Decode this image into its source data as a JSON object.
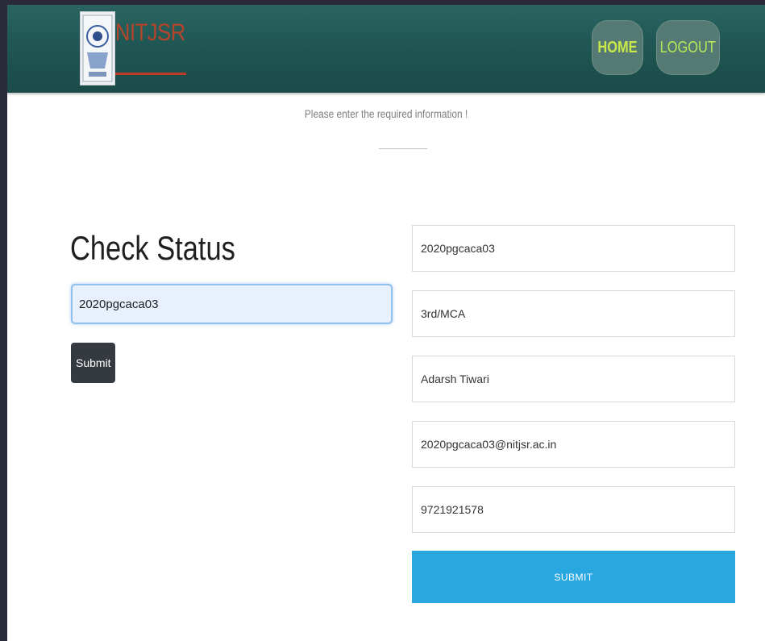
{
  "header": {
    "logo_text": "NITJSR",
    "nav": {
      "home_label": "HOME",
      "logout_label": "LOGOUT"
    },
    "colors": {
      "bar": "#1e5451",
      "nav_text": "#c9e84a",
      "logo_text": "#b5452a"
    }
  },
  "main": {
    "hint": "Please enter the required information !",
    "check_status": {
      "title": "Check Status",
      "input_value": "2020pgcaca03",
      "submit_label": "Submit"
    },
    "form": {
      "fields": [
        {
          "value": "2020pgcaca03"
        },
        {
          "value": "3rd/MCA"
        },
        {
          "value": "Adarsh Tiwari"
        },
        {
          "value": "2020pgcaca03@nitjsr.ac.in"
        },
        {
          "value": "9721921578"
        }
      ],
      "submit_label": "SUBMIT",
      "accent": "#29a8e0"
    }
  }
}
